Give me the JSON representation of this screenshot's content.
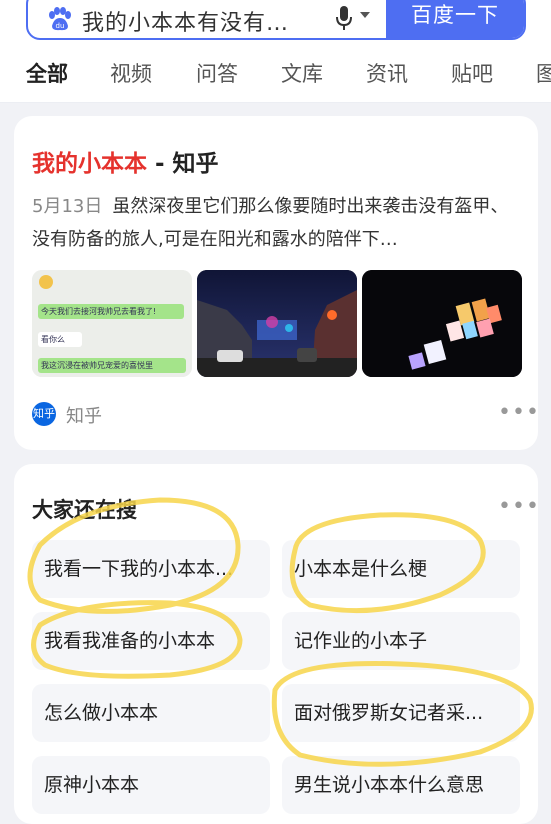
{
  "search": {
    "query": "我的小本本有没有…",
    "button_label": "百度一下"
  },
  "tabs": [
    {
      "label": "全部",
      "active": true
    },
    {
      "label": "视频"
    },
    {
      "label": "问答"
    },
    {
      "label": "文库"
    },
    {
      "label": "资讯"
    },
    {
      "label": "贴吧"
    },
    {
      "label": "图"
    }
  ],
  "result": {
    "title_highlight": "我的小本本",
    "title_rest": " - 知乎",
    "date": "5月13日",
    "snippet": "虽然深夜里它们那么像要随时出来袭击没有盔甲、没有防备的旅人,可是在阳光和露水的陪伴下…",
    "thumb1_lines": [
      "今天我们去接河我帅兄去看我了!",
      "看你么",
      "我这沉浸在被帅兄宠爱的喜悦里"
    ],
    "source_logo": "知乎",
    "source_name": "知乎",
    "more_glyph": "•••"
  },
  "related": {
    "title": "大家还在搜",
    "more_glyph": "•••",
    "items": [
      "我看一下我的小本本...",
      "小本本是什么梗",
      "我看我准备的小本本",
      "记作业的小本子",
      "怎么做小本本",
      "面对俄罗斯女记者采...",
      "原神小本本",
      "男生说小本本什么意思"
    ]
  },
  "colors": {
    "accent": "#4e6ef2",
    "highlight": "#e5322d",
    "marker": "#f7d54a"
  }
}
